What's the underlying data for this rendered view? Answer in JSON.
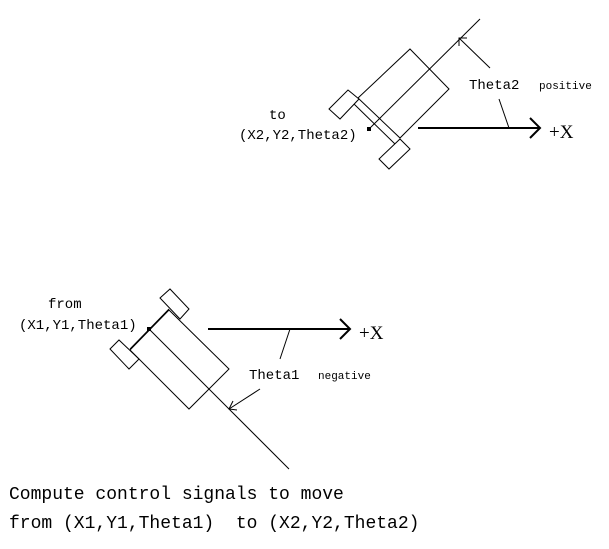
{
  "target": {
    "prefix": "to",
    "pose": "(X2,Y2,Theta2)",
    "angle_label": "Theta2",
    "angle_sign": "positive",
    "axis_label": "+X"
  },
  "start": {
    "prefix": "from",
    "pose": "(X1,Y1,Theta1)",
    "angle_label": "Theta1",
    "angle_sign": "negative",
    "axis_label": "+X"
  },
  "caption": {
    "line1": "Compute control signals to move",
    "line2": "from (X1,Y1,Theta1)  to (X2,Y2,Theta2)"
  }
}
